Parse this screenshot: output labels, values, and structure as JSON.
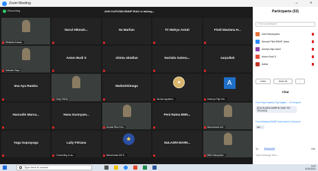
{
  "window": {
    "title": "Zoom Meeting",
    "minimize": "–",
    "close": "×"
  },
  "meeting": {
    "status_label": "Recording",
    "active_speaker": "ANG KAPUSIN BNNP RIAU is talking..."
  },
  "tiles": [
    {
      "kind": "video",
      "name": "",
      "caption": "Wiriantia Ariwas..."
    },
    {
      "kind": "name",
      "name": "Nurul Hikmah...",
      "caption": ""
    },
    {
      "kind": "name",
      "name": "Ita Marlian",
      "caption": ""
    },
    {
      "kind": "name",
      "name": "Tri Wahyu Astuti",
      "caption": ""
    },
    {
      "kind": "name",
      "name": "Findi Maulana H...",
      "caption": ""
    },
    {
      "kind": "video",
      "name": "",
      "caption": "Saharier Bayu"
    },
    {
      "kind": "name",
      "name": "Anton Budi S",
      "caption": ""
    },
    {
      "kind": "name",
      "name": "shinta oktafian",
      "caption": ""
    },
    {
      "kind": "name",
      "name": "Nurlaila Sukma...",
      "caption": ""
    },
    {
      "kind": "name",
      "name": "sarpullah",
      "caption": ""
    },
    {
      "kind": "name",
      "name": "Ima Ayu Ramba",
      "caption": ""
    },
    {
      "kind": "video",
      "name": "",
      "caption": "Deep PANA"
    },
    {
      "kind": "name",
      "name": "MaibotiSitnaga",
      "caption": ""
    },
    {
      "kind": "logo",
      "name": "",
      "caption": "Annisa Agustina..."
    },
    {
      "kind": "avatar",
      "name": "",
      "letter": "A",
      "caption": "Amenya Fajri Ula..."
    },
    {
      "kind": "name",
      "name": "Hasrudin Marsa...",
      "caption": ""
    },
    {
      "kind": "name",
      "name": "Hana Gunnyam...",
      "caption": ""
    },
    {
      "kind": "video",
      "name": "",
      "caption": "Ahmad Riko Kho..."
    },
    {
      "kind": "name",
      "name": "Peni Ratna BNN...",
      "caption": ""
    },
    {
      "kind": "video",
      "name": "",
      "caption": "Muhammad Arif..."
    },
    {
      "kind": "name",
      "name": "Yoga Suprayoga",
      "caption": ""
    },
    {
      "kind": "name",
      "name": "Laily Fitriana",
      "caption": "Connecting to au..."
    },
    {
      "kind": "badge",
      "name": "",
      "caption": "Muhammad Arif S..."
    },
    {
      "kind": "name",
      "name": "SULASRI MAIRI...",
      "caption": ""
    },
    {
      "kind": "video",
      "name": "",
      "caption": "BNN Kabupaten..."
    }
  ],
  "participants": {
    "title": "Participants (53)",
    "search_placeholder": "Find a participant",
    "list": [
      {
        "name": "sridi Hasanpatra",
        "color": "#e8743b"
      },
      {
        "name": "Ahmad Fifia BNNP Jabar",
        "color": "#2d8cff"
      },
      {
        "name": "amelya fajri ulami",
        "color": "#8e44ad"
      },
      {
        "name": "Anton Budi S",
        "color": "#e74c3c"
      },
      {
        "name": "Adilat",
        "color": "#c0392b"
      }
    ],
    "invite_label": "Invite",
    "mute_all_label": "Mute All",
    "more_label": "..."
  },
  "chat": {
    "title": "Chat",
    "messages": [
      {
        "from": "From Roja Suaaran Tog Sagitsu... to Everyone:",
        "text": "ADA SUARA AMREN SAAT KE TELINGA"
      },
      {
        "from": "From Mahamid BNNP Kala Kediri to Everyone:",
        "text": "izin ..."
      }
    ],
    "to_label": "To:",
    "to_value": "Everyone",
    "file_label": "File",
    "input_placeholder": "Type message here..."
  },
  "taskbar": {
    "search_placeholder": "Type here to search",
    "time": "9:47",
    "date": "4/10/2021"
  }
}
